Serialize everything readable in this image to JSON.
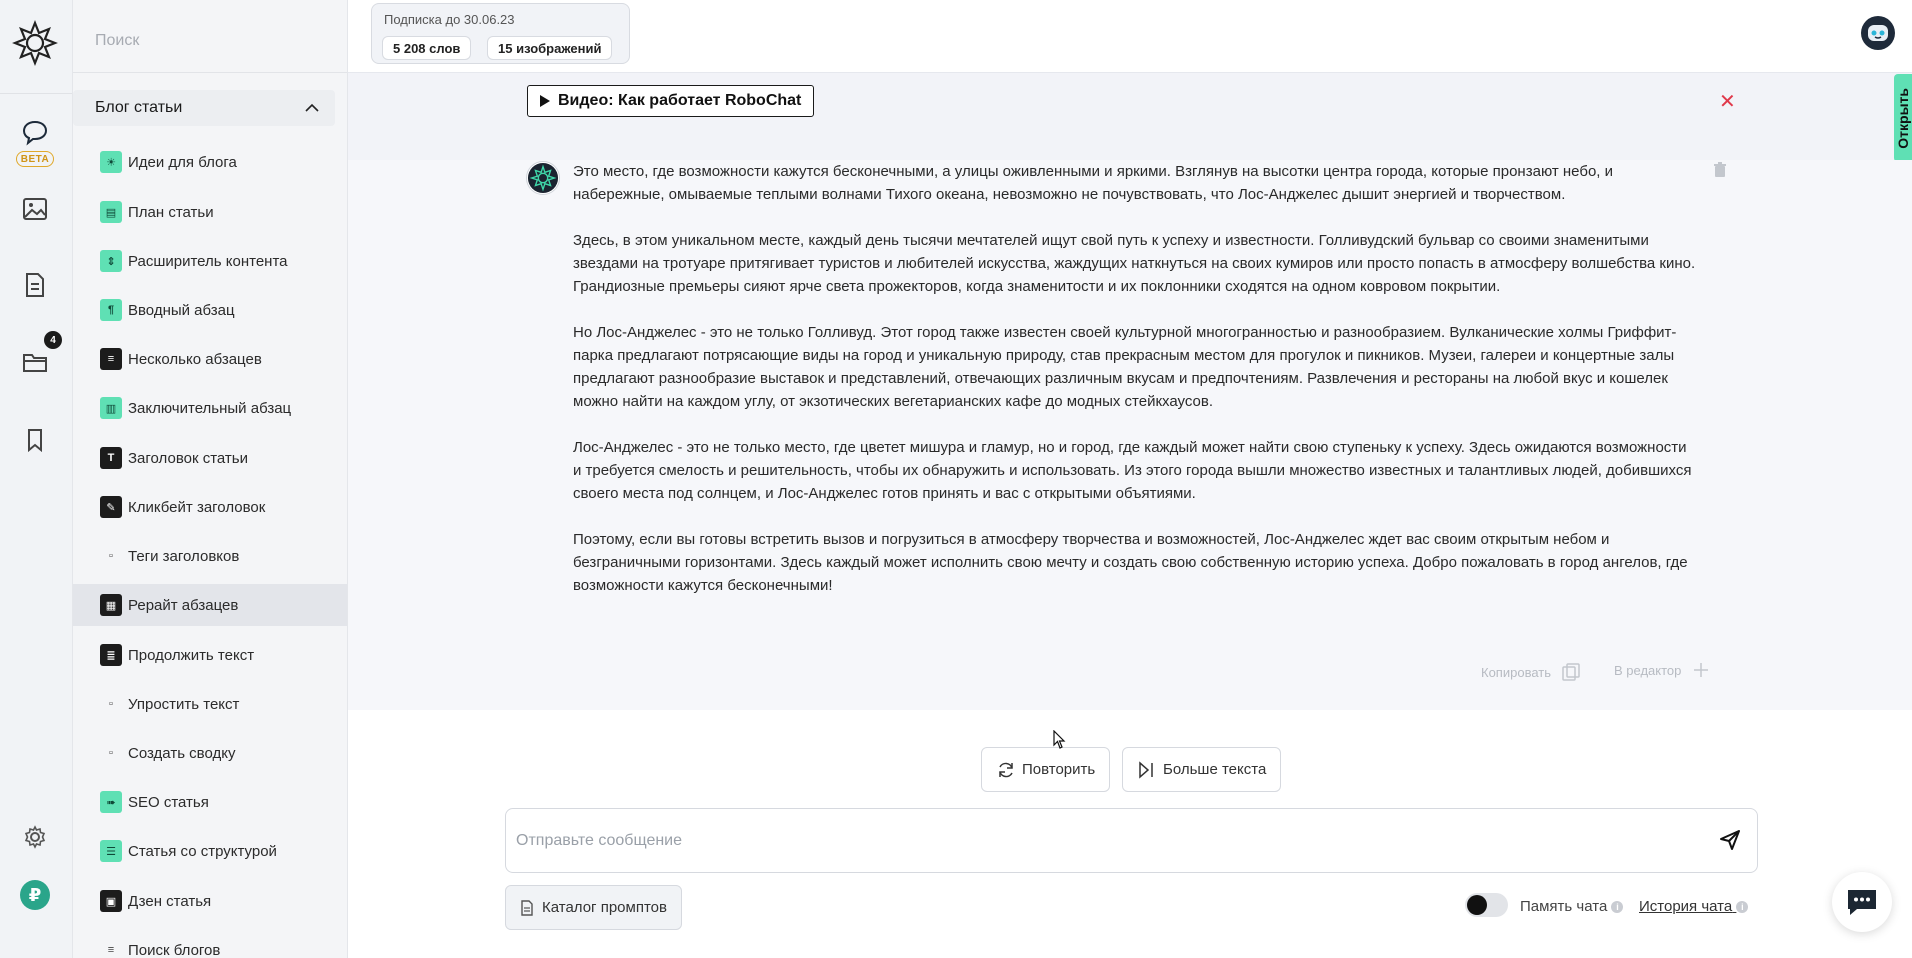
{
  "sidebar": {
    "search_placeholder": "Поиск",
    "group_title": "Блог статьи",
    "items": [
      {
        "label": "Идеи для блога",
        "icon": "lightbulb-icon"
      },
      {
        "label": "План статьи",
        "icon": "clipboard-icon"
      },
      {
        "label": "Расширитель контента",
        "icon": "expand-icon"
      },
      {
        "label": "Вводный абзац",
        "icon": "paragraph-icon"
      },
      {
        "label": "Несколько абзацев",
        "icon": "paragraphs-icon"
      },
      {
        "label": "Заключительный абзац",
        "icon": "final-paragraph-icon"
      },
      {
        "label": "Заголовок статьи",
        "icon": "title-icon"
      },
      {
        "label": "Кликбейт заголовок",
        "icon": "clickbait-icon"
      },
      {
        "label": "Теги заголовков",
        "icon": "tags-icon"
      },
      {
        "label": "Рерайт абзацев",
        "icon": "rewrite-icon"
      },
      {
        "label": "Продолжить текст",
        "icon": "continue-icon"
      },
      {
        "label": "Упростить текст",
        "icon": "simplify-icon"
      },
      {
        "label": "Создать сводку",
        "icon": "summary-icon"
      },
      {
        "label": "SEO статья",
        "icon": "seo-icon"
      },
      {
        "label": "Статья со структурой",
        "icon": "structure-icon"
      },
      {
        "label": "Дзен статья",
        "icon": "zen-icon"
      },
      {
        "label": "Поиск блогов",
        "icon": "search-blogs-icon"
      }
    ]
  },
  "rail": {
    "beta_label": "BETA",
    "folder_badge": "4"
  },
  "subscription": {
    "title": "Подписка до 30.06.23",
    "words": "5 208 слов",
    "images": "15 изображений"
  },
  "banner": {
    "video_label": "Видео: Как работает RoboChat",
    "open_tab": "Открыть"
  },
  "message": {
    "paragraphs": [
      "Это место, где возможности кажутся бесконечными, а улицы оживленными и яркими. Взглянув на высотки центра города, которые пронзают небо, и набережные, омываемые теплыми волнами Тихого океана, невозможно не почувствовать, что Лос-Анджелес дышит энергией и творчеством.",
      "Здесь, в этом уникальном месте, каждый день тысячи мечтателей ищут свой путь к успеху и известности. Голливудский бульвар со своими знаменитыми звездами на тротуаре притягивает туристов и любителей искусства, жаждущих наткнуться на своих кумиров или просто попасть в атмосферу волшебства кино. Грандиозные премьеры сияют ярче света прожекторов, когда знаменитости и их поклонники сходятся на одном ковровом покрытии.",
      "Но Лос-Анджелес - это не только Голливуд. Этот город также известен своей культурной многогранностью и разнообразием. Вулканические холмы Гриффит-парка предлагают потрясающие виды на город и уникальную природу, став прекрасным местом для прогулок и пикников. Музеи, галереи и концертные залы предлагают разнообразие выставок и представлений, отвечающих различным вкусам и предпочтениям. Развлечения и рестораны на любой вкус и кошелек можно найти на каждом углу, от экзотических вегетарианских кафе до модных стейкхаусов.",
      "Лос-Анджелес - это не только место, где цветет мишура и гламур, но и город, где каждый может найти свою ступеньку к успеху. Здесь ожидаются возможности и требуется смелость и решительность, чтобы их обнаружить и использовать. Из этого города вышли множество известных и талантливых людей, добившихся своего места под солнцем, и Лос-Анджелес готов принять и вас с открытыми объятиями.",
      "Поэтому, если вы готовы встретить вызов и погрузиться в атмосферу творчества и возможностей, Лос-Анджелес ждет вас своим открытым небом и безграничными горизонтами. Здесь каждый может исполнить свою мечту и создать свою собственную историю успеха. Добро пожаловать в город ангелов, где возможности кажутся бесконечными!"
    ],
    "copy_label": "Копировать",
    "editor_label": "В редактор"
  },
  "actions": {
    "retry_label": "Повторить",
    "more_label": "Больше текста"
  },
  "composer": {
    "placeholder": "Отправьте сообщение",
    "catalog_label": "Каталог промптов",
    "memory_label": "Память чата",
    "history_label": "История чата"
  },
  "colors": {
    "accent": "#5fe0b4",
    "close": "#e0384a",
    "beta": "#d09418",
    "ruble": "#2aa58a"
  }
}
